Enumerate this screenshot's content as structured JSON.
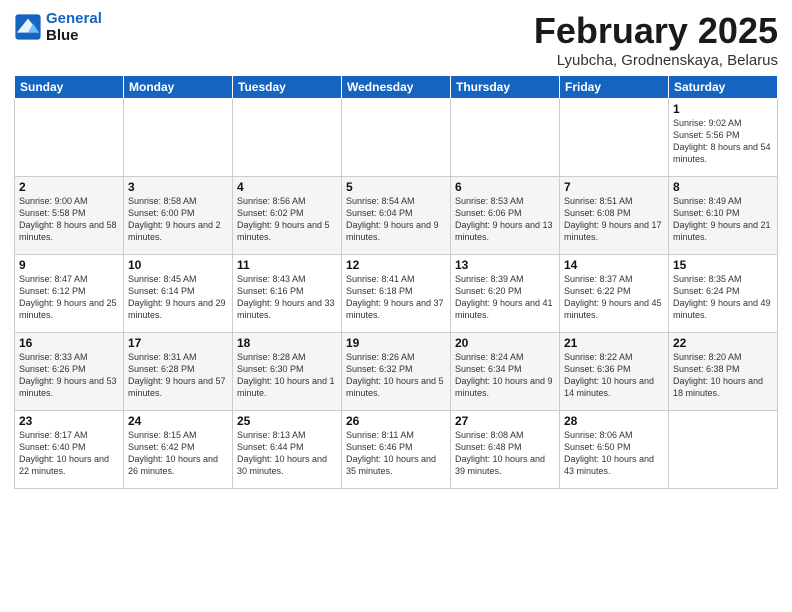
{
  "header": {
    "logo_line1": "General",
    "logo_line2": "Blue",
    "title": "February 2025",
    "subtitle": "Lyubcha, Grodnenskaya, Belarus"
  },
  "weekdays": [
    "Sunday",
    "Monday",
    "Tuesday",
    "Wednesday",
    "Thursday",
    "Friday",
    "Saturday"
  ],
  "weeks": [
    [
      {
        "day": "",
        "info": ""
      },
      {
        "day": "",
        "info": ""
      },
      {
        "day": "",
        "info": ""
      },
      {
        "day": "",
        "info": ""
      },
      {
        "day": "",
        "info": ""
      },
      {
        "day": "",
        "info": ""
      },
      {
        "day": "1",
        "info": "Sunrise: 9:02 AM\nSunset: 5:56 PM\nDaylight: 8 hours\nand 54 minutes."
      }
    ],
    [
      {
        "day": "2",
        "info": "Sunrise: 9:00 AM\nSunset: 5:58 PM\nDaylight: 8 hours\nand 58 minutes."
      },
      {
        "day": "3",
        "info": "Sunrise: 8:58 AM\nSunset: 6:00 PM\nDaylight: 9 hours\nand 2 minutes."
      },
      {
        "day": "4",
        "info": "Sunrise: 8:56 AM\nSunset: 6:02 PM\nDaylight: 9 hours\nand 5 minutes."
      },
      {
        "day": "5",
        "info": "Sunrise: 8:54 AM\nSunset: 6:04 PM\nDaylight: 9 hours\nand 9 minutes."
      },
      {
        "day": "6",
        "info": "Sunrise: 8:53 AM\nSunset: 6:06 PM\nDaylight: 9 hours\nand 13 minutes."
      },
      {
        "day": "7",
        "info": "Sunrise: 8:51 AM\nSunset: 6:08 PM\nDaylight: 9 hours\nand 17 minutes."
      },
      {
        "day": "8",
        "info": "Sunrise: 8:49 AM\nSunset: 6:10 PM\nDaylight: 9 hours\nand 21 minutes."
      }
    ],
    [
      {
        "day": "9",
        "info": "Sunrise: 8:47 AM\nSunset: 6:12 PM\nDaylight: 9 hours\nand 25 minutes."
      },
      {
        "day": "10",
        "info": "Sunrise: 8:45 AM\nSunset: 6:14 PM\nDaylight: 9 hours\nand 29 minutes."
      },
      {
        "day": "11",
        "info": "Sunrise: 8:43 AM\nSunset: 6:16 PM\nDaylight: 9 hours\nand 33 minutes."
      },
      {
        "day": "12",
        "info": "Sunrise: 8:41 AM\nSunset: 6:18 PM\nDaylight: 9 hours\nand 37 minutes."
      },
      {
        "day": "13",
        "info": "Sunrise: 8:39 AM\nSunset: 6:20 PM\nDaylight: 9 hours\nand 41 minutes."
      },
      {
        "day": "14",
        "info": "Sunrise: 8:37 AM\nSunset: 6:22 PM\nDaylight: 9 hours\nand 45 minutes."
      },
      {
        "day": "15",
        "info": "Sunrise: 8:35 AM\nSunset: 6:24 PM\nDaylight: 9 hours\nand 49 minutes."
      }
    ],
    [
      {
        "day": "16",
        "info": "Sunrise: 8:33 AM\nSunset: 6:26 PM\nDaylight: 9 hours\nand 53 minutes."
      },
      {
        "day": "17",
        "info": "Sunrise: 8:31 AM\nSunset: 6:28 PM\nDaylight: 9 hours\nand 57 minutes."
      },
      {
        "day": "18",
        "info": "Sunrise: 8:28 AM\nSunset: 6:30 PM\nDaylight: 10 hours\nand 1 minute."
      },
      {
        "day": "19",
        "info": "Sunrise: 8:26 AM\nSunset: 6:32 PM\nDaylight: 10 hours\nand 5 minutes."
      },
      {
        "day": "20",
        "info": "Sunrise: 8:24 AM\nSunset: 6:34 PM\nDaylight: 10 hours\nand 9 minutes."
      },
      {
        "day": "21",
        "info": "Sunrise: 8:22 AM\nSunset: 6:36 PM\nDaylight: 10 hours\nand 14 minutes."
      },
      {
        "day": "22",
        "info": "Sunrise: 8:20 AM\nSunset: 6:38 PM\nDaylight: 10 hours\nand 18 minutes."
      }
    ],
    [
      {
        "day": "23",
        "info": "Sunrise: 8:17 AM\nSunset: 6:40 PM\nDaylight: 10 hours\nand 22 minutes."
      },
      {
        "day": "24",
        "info": "Sunrise: 8:15 AM\nSunset: 6:42 PM\nDaylight: 10 hours\nand 26 minutes."
      },
      {
        "day": "25",
        "info": "Sunrise: 8:13 AM\nSunset: 6:44 PM\nDaylight: 10 hours\nand 30 minutes."
      },
      {
        "day": "26",
        "info": "Sunrise: 8:11 AM\nSunset: 6:46 PM\nDaylight: 10 hours\nand 35 minutes."
      },
      {
        "day": "27",
        "info": "Sunrise: 8:08 AM\nSunset: 6:48 PM\nDaylight: 10 hours\nand 39 minutes."
      },
      {
        "day": "28",
        "info": "Sunrise: 8:06 AM\nSunset: 6:50 PM\nDaylight: 10 hours\nand 43 minutes."
      },
      {
        "day": "",
        "info": ""
      }
    ]
  ]
}
